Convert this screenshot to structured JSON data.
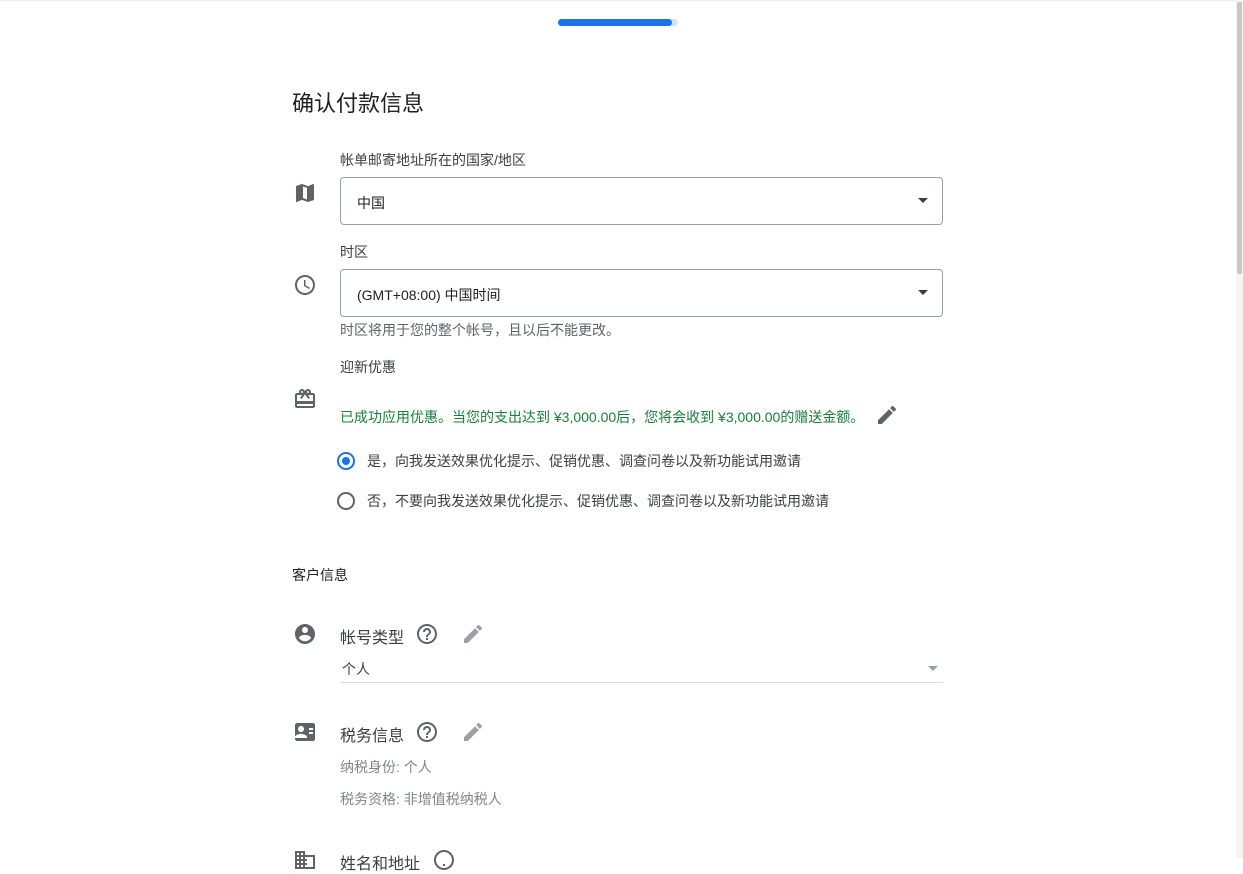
{
  "page": {
    "title": "确认付款信息",
    "progress_fraction": 0.95
  },
  "billing_country": {
    "label": "帐单邮寄地址所在的国家/地区",
    "value": "中国",
    "icon": "map-icon"
  },
  "timezone": {
    "label": "时区",
    "value": "(GMT+08:00) 中国时间",
    "hint": "时区将用于您的整个帐号，且以后不能更改。",
    "icon": "clock-icon"
  },
  "promo": {
    "label": "迎新优惠",
    "message": "已成功应用优惠。当您的支出达到 ¥3,000.00后，您将会收到 ¥3,000.00的赠送金额。",
    "icon": "gift-icon",
    "edit_icon": "pencil-icon"
  },
  "marketing_options": [
    {
      "label": "是，向我发送效果优化提示、促销优惠、调查问卷以及新功能试用邀请",
      "checked": true
    },
    {
      "label": "否，不要向我发送效果优化提示、促销优惠、调查问卷以及新功能试用邀请",
      "checked": false
    }
  ],
  "customer_info": {
    "section_title": "客户信息",
    "account_type": {
      "title": "帐号类型",
      "value": "个人",
      "icon": "account-circle-icon"
    },
    "tax_info": {
      "title": "税务信息",
      "line1": "纳税身份: 个人",
      "line2": "税务资格: 非增值税纳税人",
      "icon": "id-card-icon"
    },
    "next_row": {
      "title": "姓名和地址",
      "icon": "business-icon"
    }
  },
  "colors": {
    "accent": "#1a73e8",
    "success_text": "#188038",
    "border": "#9aa0a6"
  }
}
